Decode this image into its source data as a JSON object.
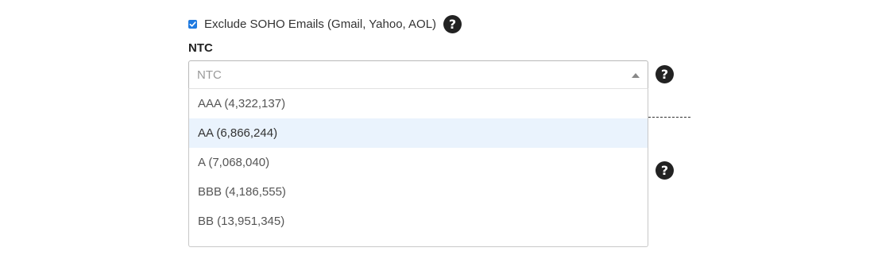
{
  "checkbox": {
    "checked": true,
    "label": "Exclude SOHO Emails (Gmail, Yahoo, AOL)"
  },
  "help_icon_glyph": "?",
  "ntc_field": {
    "label": "NTC",
    "placeholder": "NTC",
    "options": [
      {
        "label": "AAA (4,322,137)",
        "highlighted": false
      },
      {
        "label": "AA (6,866,244)",
        "highlighted": true
      },
      {
        "label": "A (7,068,040)",
        "highlighted": false
      },
      {
        "label": "BBB (4,186,555)",
        "highlighted": false
      },
      {
        "label": "BB (13,951,345)",
        "highlighted": false
      }
    ]
  },
  "colors": {
    "accent": "#1f7ae0",
    "highlight": "#eaf3fd",
    "help_icon_bg": "#222222"
  },
  "icons": {
    "help": "question-circle-icon",
    "caret": "caret-up-icon",
    "check": "checkmark-icon"
  }
}
